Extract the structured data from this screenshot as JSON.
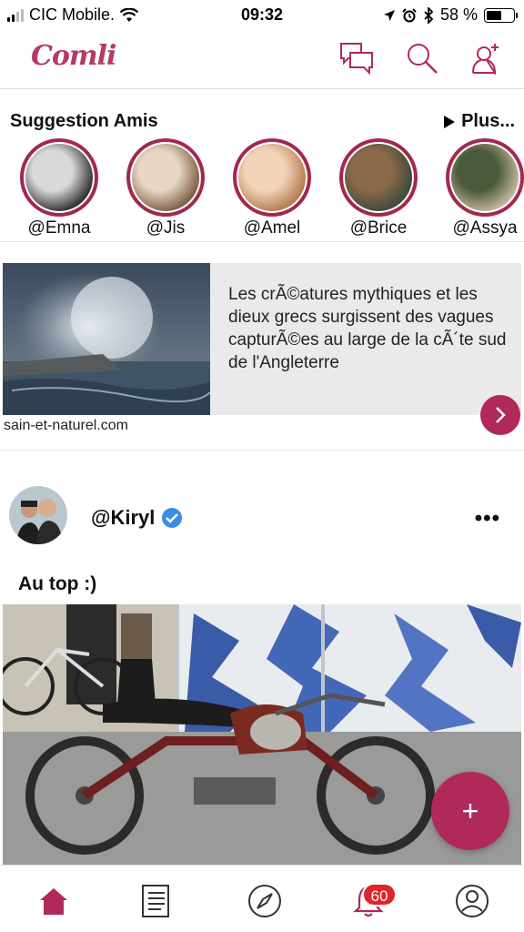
{
  "status_bar": {
    "carrier": "CIC Mobile.",
    "time": "09:32",
    "battery_text": "58 %",
    "battery_level": 0.58
  },
  "header": {
    "logo": "Comli",
    "icons": [
      "chat-icon",
      "search-icon",
      "add-friend-icon"
    ]
  },
  "suggestions": {
    "title": "Suggestion Amis",
    "more_label": "Plus...",
    "friends": [
      {
        "handle": "@Emna",
        "avatar_colors": [
          "#2a2a2a",
          "#d9d9d9"
        ]
      },
      {
        "handle": "@Jis",
        "avatar_colors": [
          "#7a5a3f",
          "#e8d7c4"
        ]
      },
      {
        "handle": "@Amel",
        "avatar_colors": [
          "#b07a4a",
          "#f2d4b8"
        ]
      },
      {
        "handle": "@Brice",
        "avatar_colors": [
          "#3b4a3a",
          "#8a6a4a"
        ]
      },
      {
        "handle": "@Assya",
        "avatar_colors": [
          "#c9b9a0",
          "#4a5a3a"
        ]
      }
    ]
  },
  "link_card": {
    "text": "Les crÃ©atures mythiques et les dieux grecs surgissent des vagues capturÃ©es au large de la cÃ´te sud de l'Angleterre",
    "source": "sain-et-naturel.com"
  },
  "post": {
    "username": "@Kiryl",
    "caption": "Au top :)",
    "more": "•••"
  },
  "fab_label": "+",
  "tab_bar": {
    "tabs": [
      "home-icon",
      "feed-icon",
      "explore-icon",
      "notifications-icon",
      "profile-icon"
    ],
    "notification_count": "60",
    "active_color": "#b0295a"
  }
}
